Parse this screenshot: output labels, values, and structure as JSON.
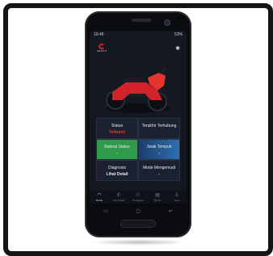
{
  "status_bar": {
    "time": "10:45",
    "battery": "53%"
  },
  "brand": {
    "logo_text": "GESITS"
  },
  "cards": [
    {
      "label": "Status",
      "value": "Terkunci"
    },
    {
      "label": "Terakhir Terhubung",
      "value": ""
    },
    {
      "label": "Baterai Status",
      "value": "-"
    },
    {
      "label": "Jarak Tempuh",
      "value": "-"
    },
    {
      "label": "Diagnosis",
      "value": "Lihat Detail"
    },
    {
      "label": "Mode Mengemudi",
      "value": "-"
    }
  ],
  "tabs": [
    {
      "label": "Home",
      "icon": "speedometer-icon",
      "active": true
    },
    {
      "label": "Cari Dealer",
      "icon": "phone-icon",
      "active": false
    },
    {
      "label": "Pengguna",
      "icon": "users-icon",
      "active": false
    },
    {
      "label": "Berita",
      "icon": "news-icon",
      "active": false
    },
    {
      "label": "Akun",
      "icon": "user-icon",
      "active": false
    }
  ],
  "colors": {
    "accent_red": "#e53935",
    "battery_green": "#2e9b4a",
    "range_blue": "#2c6fb0",
    "screen_bg": "#141821"
  }
}
